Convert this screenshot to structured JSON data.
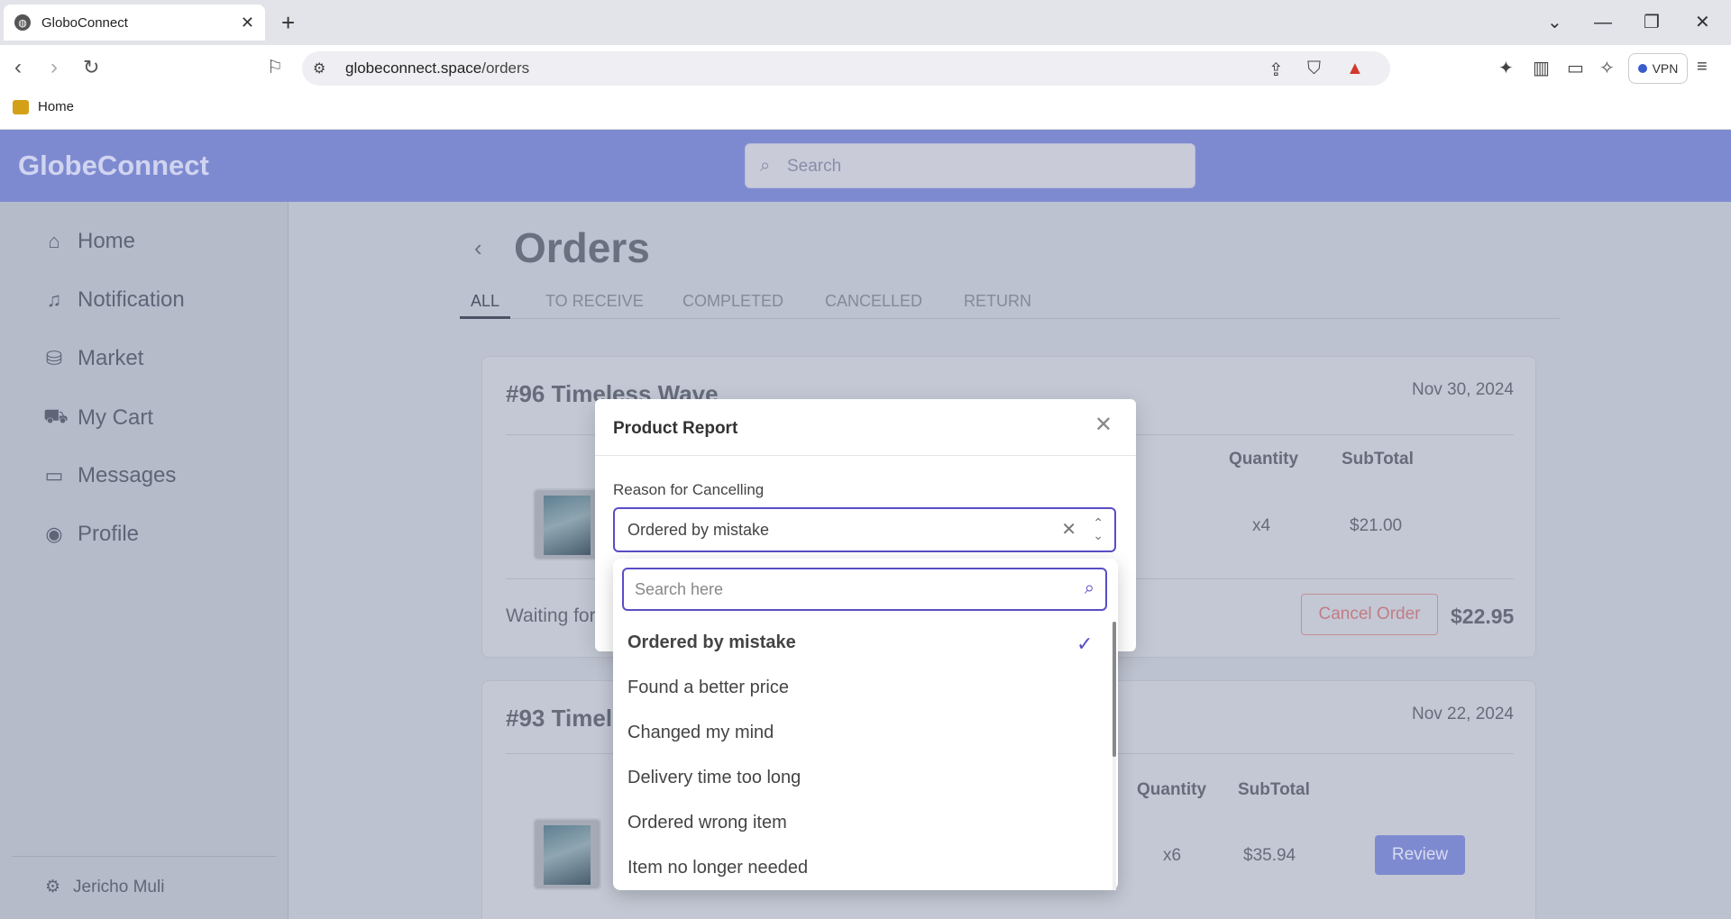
{
  "browser": {
    "tab_title": "GloboConnect",
    "url_host": "globeconnect.space",
    "url_path": "/orders",
    "bookmark_home": "Home",
    "vpn_label": "VPN"
  },
  "app": {
    "logo": "GlobeConnect",
    "search_placeholder": "Search",
    "accent_color": "#7e8ad0"
  },
  "sidebar": {
    "items": [
      {
        "label": "Home",
        "icon": "home-icon"
      },
      {
        "label": "Notification",
        "icon": "bell-icon"
      },
      {
        "label": "Market",
        "icon": "bag-icon"
      },
      {
        "label": "My Cart",
        "icon": "cart-icon"
      },
      {
        "label": "Messages",
        "icon": "message-icon"
      },
      {
        "label": "Profile",
        "icon": "user-icon"
      }
    ],
    "user": "Jericho Muli"
  },
  "orders": {
    "title": "Orders",
    "tabs": [
      "ALL",
      "TO RECEIVE",
      "COMPLETED",
      "CANCELLED",
      "RETURN"
    ],
    "active_tab": "ALL",
    "cards": [
      {
        "title": "#96 Timeless Wave",
        "date": "Nov 30, 2024",
        "quantity_header": "Quantity",
        "subtotal_header": "SubTotal",
        "quantity": "x4",
        "subtotal": "$21.00",
        "status": "Waiting for",
        "action": "Cancel Order",
        "total": "$22.95"
      },
      {
        "title": "#93 Timel",
        "date": "Nov 22, 2024",
        "quantity_header": "Quantity",
        "subtotal_header": "SubTotal",
        "quantity": "x6",
        "subtotal": "$35.94",
        "action": "Review"
      }
    ]
  },
  "modal": {
    "title": "Product Report",
    "field_label": "Reason for Cancelling",
    "selected_value": "Ordered by mistake",
    "dropdown_search_placeholder": "Search here",
    "options": [
      "Ordered by mistake",
      "Found a better price",
      "Changed my mind",
      "Delivery time too long",
      "Ordered wrong item",
      "Item no longer needed"
    ]
  }
}
